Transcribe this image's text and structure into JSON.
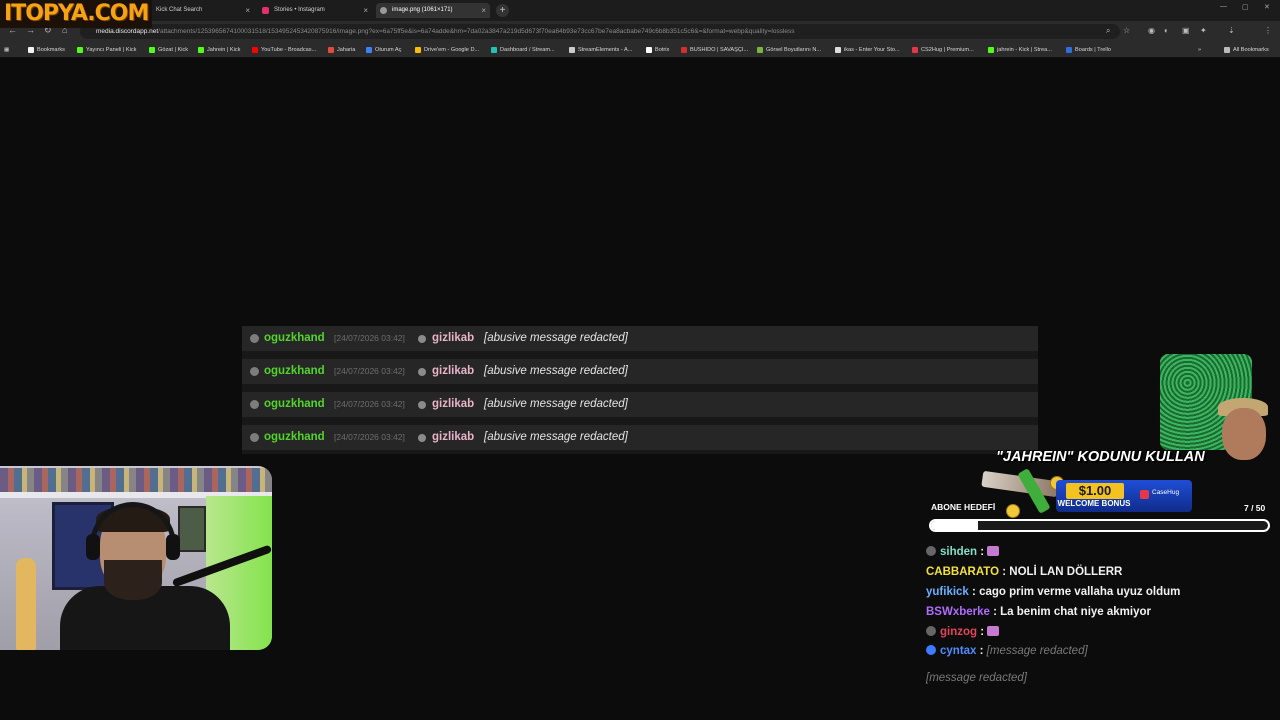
{
  "site_logo": "ITOPYA.COM",
  "browser": {
    "tabs": [
      {
        "title": "Kick Chat Search",
        "favicon_color": "#53fc18",
        "active": false
      },
      {
        "title": "Stories • Instagram",
        "favicon_color": "#e1306c",
        "active": false
      },
      {
        "title": "image.png (1061×171)",
        "favicon_color": "#9a9a9a",
        "active": true
      }
    ],
    "url_host": "media.discordapp.net",
    "url_path": "/attachments/1253965674100031518/1534952453420875916/image.png?ex=6a75ff5e&is=6a74adde&hm=7da02a3847a219d5d673f70ea64b93e73cc67be7ea8acbabe749c6b8b351c5c6&=&format=webp&quality=lossless",
    "bookmarks": [
      {
        "label": "Bookmarks",
        "icon": "star-icon",
        "color": "#f2f2f2"
      },
      {
        "label": "Yayıncı Paneli | Kick",
        "icon": "kick-icon",
        "color": "#53fc18"
      },
      {
        "label": "Gözat | Kick",
        "icon": "kick-icon",
        "color": "#53fc18"
      },
      {
        "label": "Jahrein | Kick",
        "icon": "kick-icon",
        "color": "#53fc18"
      },
      {
        "label": "YouTube - Broadcas...",
        "icon": "youtube-icon",
        "color": "#ff0000"
      },
      {
        "label": "Jaharia",
        "icon": "site-icon",
        "color": "#e24a3a"
      },
      {
        "label": "Oturum Aç",
        "icon": "site-icon",
        "color": "#3b82f6"
      },
      {
        "label": "Drive'em - Google D...",
        "icon": "drive-icon",
        "color": "#fbbc04"
      },
      {
        "label": "Dashboard / Stream...",
        "icon": "site-icon",
        "color": "#22c1b5"
      },
      {
        "label": "StreamElements - A...",
        "icon": "site-icon",
        "color": "#cccccc"
      },
      {
        "label": "Botrix",
        "icon": "site-icon",
        "color": "#ffffff"
      },
      {
        "label": "BUSHIDO | SAVAŞÇI...",
        "icon": "site-icon",
        "color": "#d32f2f"
      },
      {
        "label": "Görsel Boyutlarını N...",
        "icon": "site-icon",
        "color": "#7cb342"
      },
      {
        "label": "ikas - Enter Your Sto...",
        "icon": "site-icon",
        "color": "#dddddd"
      },
      {
        "label": "CS2Hug | Premium...",
        "icon": "site-icon",
        "color": "#e3384a"
      },
      {
        "label": "jahrein - Kick | Strea...",
        "icon": "kick-icon",
        "color": "#53fc18"
      },
      {
        "label": "Boards | Trello",
        "icon": "trello-icon",
        "color": "#2f6fdb"
      }
    ],
    "all_bookmarks": "All Bookmarks"
  },
  "chat_log": {
    "rows": [
      {
        "user": "oguzkhand",
        "time": "[24/07/2026 03:42]",
        "target": "gizlikab",
        "message": "[abusive message redacted]"
      },
      {
        "user": "oguzkhand",
        "time": "[24/07/2026 03:42]",
        "target": "gizlikab",
        "message": "[abusive message redacted]"
      },
      {
        "user": "oguzkhand",
        "time": "[24/07/2026 03:42]",
        "target": "gizlikab",
        "message": "[abusive message redacted]"
      },
      {
        "user": "oguzkhand",
        "time": "[24/07/2026 03:42]",
        "target": "gizlikab",
        "message": "[abusive message redacted]"
      }
    ]
  },
  "overlay": {
    "promo_title": "\"JAHREIN\" KODUNU KULLAN",
    "bonus_amount": "$1.00",
    "bonus_label": "WELCOME BONUS",
    "brand": "CaseHug",
    "goal_label": "ABONE HEDEFİ",
    "goal_count": "7 / 50",
    "goal_progress": 0.14
  },
  "stream_chat": [
    {
      "user": "sihden",
      "color": "#7fe0c8",
      "text": "",
      "emote": true,
      "icon": true
    },
    {
      "user": "CABBARATO",
      "color": "#f2e13a",
      "text": "NOLİ LAN DÖLLERR",
      "emote": false,
      "icon": false
    },
    {
      "user": "yufikick",
      "color": "#6ab0ff",
      "text": "cago prim verme vallaha uyuz oldum",
      "emote": false,
      "icon": false
    },
    {
      "user": "BSWxberke",
      "color": "#b06cff",
      "text": "La benim chat niye akmiyor",
      "emote": false,
      "icon": false
    },
    {
      "user": "ginzog",
      "color": "#e0455a",
      "text": "",
      "emote": true,
      "icon": true
    },
    {
      "user": "cyntax",
      "color": "#4f8cff",
      "text": "[message redacted]",
      "emote": false,
      "icon": true
    },
    {
      "user": "",
      "color": "#f2f2f2",
      "text": "[message redacted]",
      "emote": false,
      "icon": false
    }
  ]
}
